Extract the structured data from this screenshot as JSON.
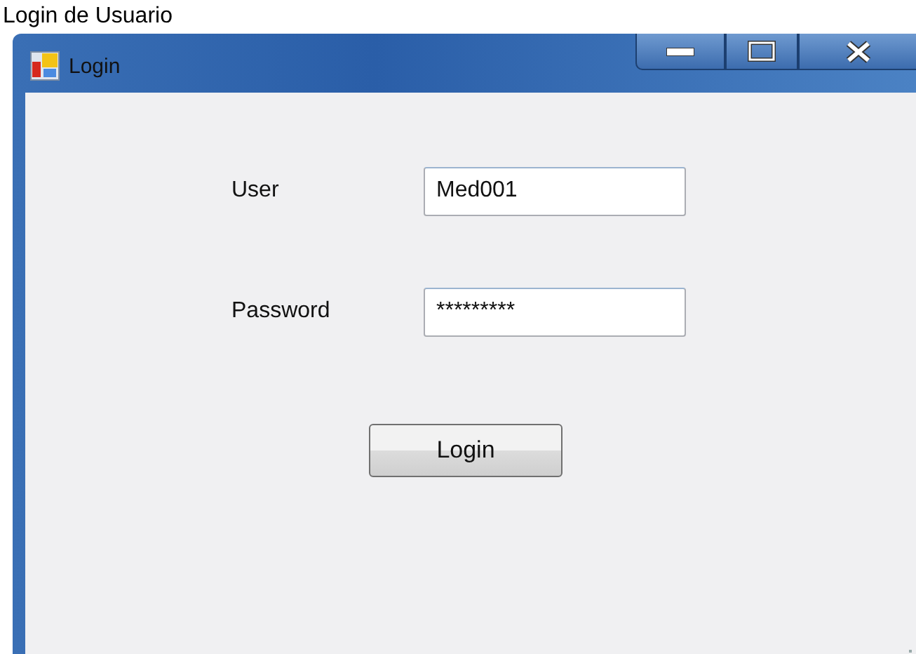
{
  "caption": "Login de Usuario",
  "window": {
    "title": "Login"
  },
  "fields": [
    {
      "label": "User",
      "value": "Med001"
    },
    {
      "label": "Password",
      "value": "*********"
    }
  ],
  "buttons": [
    "Login"
  ]
}
